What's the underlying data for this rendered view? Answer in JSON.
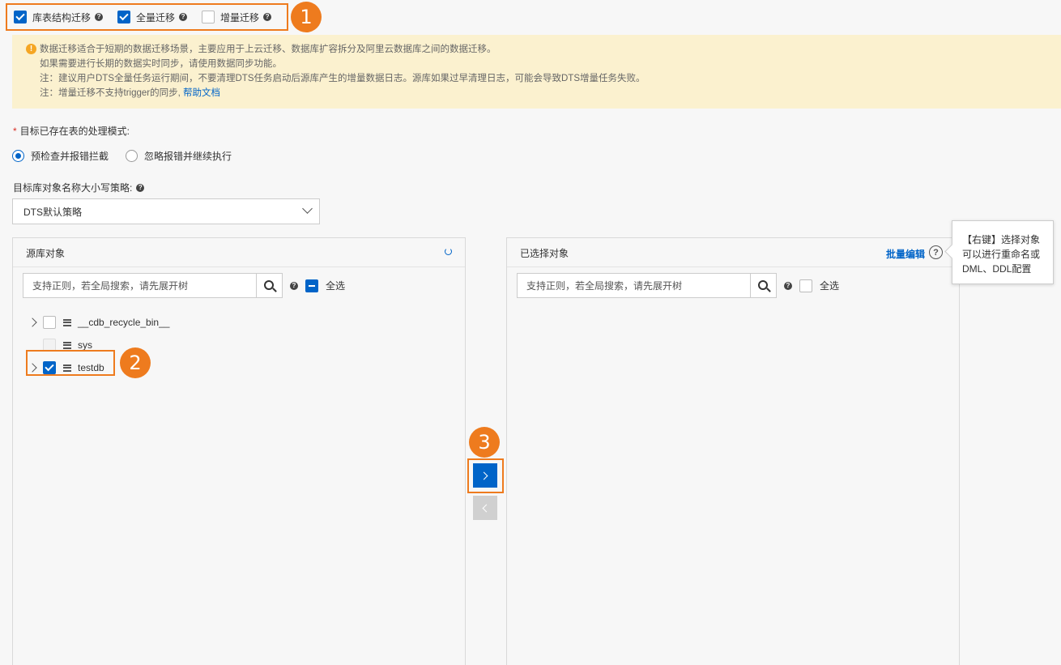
{
  "migration_types": [
    {
      "label": "库表结构迁移",
      "checked": true
    },
    {
      "label": "全量迁移",
      "checked": true
    },
    {
      "label": "增量迁移",
      "checked": false
    }
  ],
  "badges": [
    "1",
    "2",
    "3"
  ],
  "notice": {
    "line1": "数据迁移适合于短期的数据迁移场景，主要应用于上云迁移、数据库扩容拆分及阿里云数据库之间的数据迁移。",
    "line2": "如果需要进行长期的数据实时同步，请使用数据同步功能。",
    "line3": "注：建议用户DTS全量任务运行期间，不要清理DTS任务启动后源库产生的增量数据日志。源库如果过早清理日志，可能会导致DTS增量任务失败。",
    "line4": "注：增量迁移不支持trigger的同步,",
    "help_link": "帮助文档"
  },
  "existing_table": {
    "label": "目标已存在表的处理模式:",
    "options": [
      "预检查并报错拦截",
      "忽略报错并继续执行"
    ],
    "selected": 0
  },
  "case_policy": {
    "label": "目标库对象名称大小写策略:",
    "value": "DTS默认策略"
  },
  "source_panel": {
    "title": "源库对象",
    "search_placeholder": "支持正则，若全局搜索，请先展开树",
    "select_all": "全选",
    "items": [
      {
        "name": "__cdb_recycle_bin__",
        "checked": false,
        "disabled": false,
        "expandable": true
      },
      {
        "name": "sys",
        "checked": false,
        "disabled": true,
        "expandable": false
      },
      {
        "name": "testdb",
        "checked": true,
        "disabled": false,
        "expandable": true
      }
    ]
  },
  "target_panel": {
    "title": "已选择对象",
    "batch_edit": "批量编辑",
    "search_placeholder": "支持正则，若全局搜索，请先展开树",
    "select_all": "全选"
  },
  "tooltip": {
    "line1": "【右键】选择对象",
    "line2": "可以进行重命名或",
    "line3": "DML、DDL配置"
  },
  "colors": {
    "accent": "#0064c8",
    "highlight": "#ee7b1e",
    "notice_bg": "#fbf1cf"
  }
}
